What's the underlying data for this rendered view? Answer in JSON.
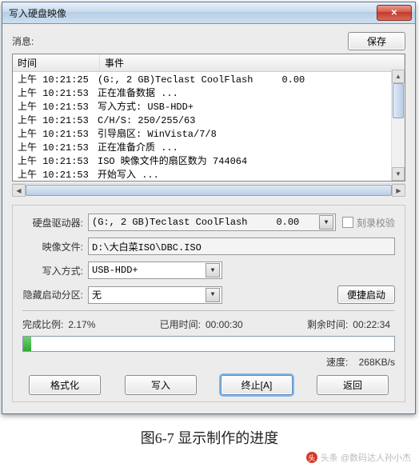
{
  "window": {
    "title": "写入硬盘映像"
  },
  "msg": {
    "label": "消息:",
    "save": "保存"
  },
  "log": {
    "headers": {
      "time": "时间",
      "event": "事件"
    },
    "rows": [
      {
        "time": "上午 10:21:25",
        "event": "(G:, 2 GB)Teclast CoolFlash     0.00"
      },
      {
        "time": "上午 10:21:53",
        "event": "正在准备数据 ..."
      },
      {
        "time": "上午 10:21:53",
        "event": "写入方式: USB-HDD+"
      },
      {
        "time": "上午 10:21:53",
        "event": "C/H/S: 250/255/63"
      },
      {
        "time": "上午 10:21:53",
        "event": "引导扇区: WinVista/7/8"
      },
      {
        "time": "上午 10:21:53",
        "event": "正在准备介质 ..."
      },
      {
        "time": "上午 10:21:53",
        "event": "ISO 映像文件的扇区数为 744064"
      },
      {
        "time": "上午 10:21:53",
        "event": "开始写入 ..."
      }
    ]
  },
  "form": {
    "drive_label": "硬盘驱动器:",
    "drive_value": "(G:, 2 GB)Teclast CoolFlash     0.00",
    "burn_verify": "刻录校验",
    "image_label": "映像文件:",
    "image_value": "D:\\大白菜ISO\\DBC.ISO",
    "write_label": "写入方式:",
    "write_value": "USB-HDD+",
    "hidden_label": "隐藏启动分区:",
    "hidden_value": "无",
    "conv_boot": "便捷启动"
  },
  "progress": {
    "done_label": "完成比例:",
    "done_value": "2.17%",
    "elapsed_label": "已用时间:",
    "elapsed_value": "00:00:30",
    "remain_label": "剩余时间:",
    "remain_value": "00:22:34",
    "speed_label": "速度:",
    "speed_value": "268KB/s"
  },
  "buttons": {
    "format": "格式化",
    "write": "写入",
    "abort": "终止[A]",
    "back": "返回"
  },
  "caption": "图6-7  显示制作的进度",
  "watermark": "头条 @数码达人孙小杰"
}
